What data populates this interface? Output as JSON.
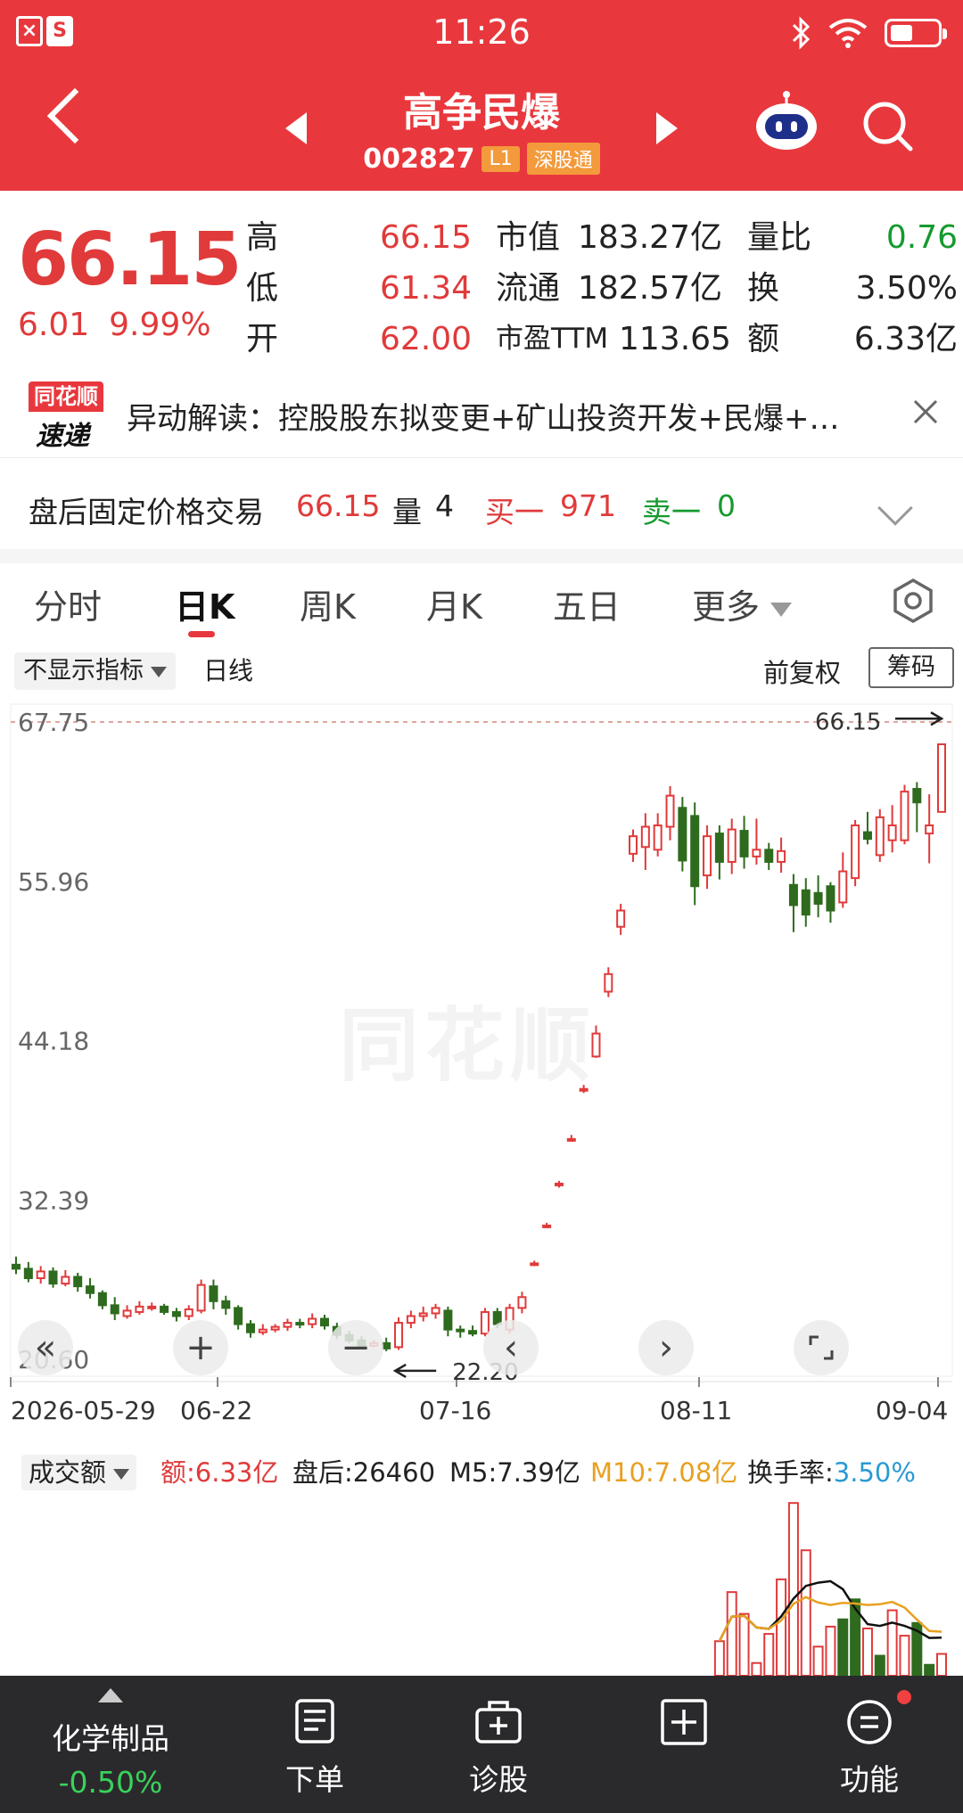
{
  "status": {
    "time": "11:26"
  },
  "header": {
    "stock_name": "高争民爆",
    "stock_code": "002827",
    "tags": [
      "L1",
      "深股通"
    ]
  },
  "quote": {
    "price": "66.15",
    "change": "6.01",
    "change_pct": "9.99%",
    "rows": [
      [
        {
          "label": "高",
          "value": "66.15"
        },
        {
          "label": "市值",
          "value": "183.27亿"
        },
        {
          "label": "量比",
          "value": "0.76"
        }
      ],
      [
        {
          "label": "低",
          "value": "61.34"
        },
        {
          "label": "流通",
          "value": "182.57亿"
        },
        {
          "label": "换",
          "value": "3.50%"
        }
      ],
      [
        {
          "label": "开",
          "value": "62.00"
        },
        {
          "label": "市盈TTM",
          "value": "113.65"
        },
        {
          "label": "额",
          "value": "6.33亿"
        }
      ]
    ]
  },
  "alert": {
    "logo_top": "同花顺",
    "logo_bottom": "速递",
    "text": "异动解读：控股股东拟变更+矿山投资开发+民爆+…"
  },
  "after_hours": {
    "label": "盘后固定价格交易",
    "price": "66.15",
    "vol_label": "量",
    "vol": "4",
    "buy_label": "买一",
    "buy": "971",
    "sell_label": "卖一",
    "sell": "0"
  },
  "tabs": [
    "分时",
    "日K",
    "周K",
    "月K",
    "五日",
    "更多"
  ],
  "active_tab": "日K",
  "chart_toolbar": {
    "indicator": "不显示指标",
    "line_type": "日线",
    "adjust": "前复权",
    "chips": "筹码"
  },
  "chart_data": {
    "type": "candlestick",
    "y_ticks": [
      "67.75",
      "55.96",
      "44.18",
      "32.39",
      "20.60"
    ],
    "ylim": [
      20.6,
      67.75
    ],
    "x_ticks": [
      "2026-05-29",
      "06-22",
      "07-16",
      "08-11",
      "09-04"
    ],
    "high_marker": "66.15",
    "low_marker": "22.20",
    "candles": [
      [
        27.6,
        27.3,
        28.2,
        26.9
      ],
      [
        27.3,
        26.6,
        27.8,
        26.3
      ],
      [
        26.6,
        27.1,
        27.5,
        26.2
      ],
      [
        27.1,
        26.2,
        27.4,
        25.9
      ],
      [
        26.2,
        26.7,
        27.2,
        26.0
      ],
      [
        26.7,
        26.0,
        27.0,
        25.6
      ],
      [
        26.0,
        25.5,
        26.6,
        25.1
      ],
      [
        25.5,
        24.6,
        25.7,
        24.3
      ],
      [
        24.6,
        24.0,
        25.2,
        23.5
      ],
      [
        23.8,
        24.2,
        24.6,
        23.6
      ],
      [
        24.1,
        24.5,
        24.9,
        23.9
      ],
      [
        24.5,
        24.5,
        24.8,
        24.2
      ],
      [
        24.5,
        24.1,
        24.7,
        23.9
      ],
      [
        24.1,
        23.8,
        24.4,
        23.4
      ],
      [
        23.8,
        24.3,
        24.6,
        23.5
      ],
      [
        24.2,
        26.1,
        26.5,
        24.0
      ],
      [
        26.0,
        24.9,
        26.5,
        24.3
      ],
      [
        24.9,
        24.4,
        25.3,
        23.9
      ],
      [
        24.4,
        23.2,
        24.6,
        22.8
      ],
      [
        23.2,
        22.6,
        23.5,
        22.2
      ],
      [
        22.6,
        22.8,
        23.2,
        22.4
      ],
      [
        22.8,
        23.0,
        23.2,
        22.6
      ],
      [
        23.0,
        23.3,
        23.6,
        22.7
      ],
      [
        23.3,
        23.2,
        23.6,
        22.9
      ],
      [
        23.2,
        23.6,
        24.0,
        22.9
      ],
      [
        23.6,
        23.1,
        23.9,
        22.8
      ],
      [
        23.0,
        22.4,
        23.3,
        22.1
      ],
      [
        22.4,
        22.0,
        22.7,
        21.8
      ],
      [
        22.0,
        21.6,
        22.3,
        21.4
      ],
      [
        21.6,
        21.8,
        22.0,
        21.5
      ],
      [
        21.8,
        21.4,
        22.2,
        21.2
      ],
      [
        21.5,
        23.3,
        23.7,
        21.3
      ],
      [
        23.3,
        23.8,
        24.2,
        22.9
      ],
      [
        23.8,
        24.0,
        24.5,
        23.4
      ],
      [
        24.0,
        24.4,
        24.7,
        23.6
      ],
      [
        24.2,
        22.8,
        24.5,
        22.3
      ],
      [
        22.8,
        22.7,
        23.1,
        22.2
      ],
      [
        22.7,
        22.5,
        23.1,
        22.3
      ],
      [
        22.5,
        24.1,
        24.4,
        22.3
      ],
      [
        24.1,
        23.2,
        24.4,
        22.9
      ],
      [
        22.8,
        24.4,
        24.7,
        22.5
      ],
      [
        24.4,
        25.2,
        25.6,
        24.0
      ],
      [
        27.7,
        27.7,
        27.9,
        27.5
      ],
      [
        30.5,
        30.5,
        30.7,
        30.3
      ],
      [
        33.5,
        33.6,
        33.8,
        33.3
      ],
      [
        36.9,
        36.9,
        37.2,
        36.7
      ],
      [
        40.6,
        40.6,
        40.9,
        40.3
      ],
      [
        43.0,
        44.7,
        45.3,
        42.9
      ],
      [
        47.8,
        49.1,
        49.6,
        47.4
      ],
      [
        52.6,
        53.8,
        54.3,
        52.0
      ],
      [
        58.0,
        59.3,
        59.8,
        57.4
      ],
      [
        58.5,
        60.0,
        61.0,
        56.8
      ],
      [
        58.3,
        60.1,
        61.0,
        57.8
      ],
      [
        60.0,
        62.3,
        63.0,
        59.0
      ],
      [
        61.4,
        57.5,
        62.2,
        56.7
      ],
      [
        60.8,
        55.6,
        61.8,
        54.2
      ],
      [
        56.4,
        59.3,
        60.1,
        55.4
      ],
      [
        59.5,
        57.4,
        60.1,
        56.1
      ],
      [
        57.4,
        59.8,
        60.6,
        56.5
      ],
      [
        59.7,
        57.8,
        60.8,
        56.9
      ],
      [
        57.8,
        58.3,
        60.6,
        57.2
      ],
      [
        58.3,
        57.4,
        58.8,
        56.8
      ],
      [
        57.4,
        58.2,
        59.2,
        56.6
      ],
      [
        55.7,
        54.2,
        56.5,
        52.2
      ],
      [
        55.3,
        53.5,
        56.2,
        52.6
      ],
      [
        55.1,
        54.3,
        56.4,
        53.3
      ],
      [
        55.6,
        53.8,
        55.9,
        52.9
      ],
      [
        54.4,
        56.7,
        58.1,
        54.0
      ],
      [
        56.2,
        60.1,
        60.5,
        55.6
      ],
      [
        59.6,
        59.1,
        61.1,
        58.7
      ],
      [
        57.9,
        60.7,
        61.3,
        57.4
      ],
      [
        59.0,
        60.1,
        61.6,
        58.1
      ],
      [
        59.0,
        62.6,
        63.1,
        58.7
      ],
      [
        62.8,
        61.8,
        63.3,
        59.6
      ],
      [
        59.5,
        60.1,
        62.4,
        57.3
      ],
      [
        61.1,
        66.1,
        66.1,
        61.1
      ]
    ]
  },
  "chart_controls": [
    "«",
    "+",
    "−",
    "‹",
    "›"
  ],
  "volume": {
    "selector": "成交额",
    "amount_label": "额:",
    "amount": "6.33亿",
    "after_label": "盘后:",
    "after": "26460",
    "m5_label": "M5:",
    "m5": "7.39亿",
    "m10_label": "M10:",
    "m10": "7.08亿",
    "turnover_label": "换手率:",
    "turnover": "3.50%",
    "bars": [
      0.19,
      0.46,
      0.34,
      0.07,
      0.23,
      0.53,
      0.95,
      0.69,
      0.16,
      0.27,
      0.31,
      0.42,
      0.26,
      0.11,
      0.36,
      0.22,
      0.29,
      0.06,
      0.12
    ],
    "bar_dirs": [
      "up",
      "up",
      "up",
      "up",
      "up",
      "up",
      "up",
      "up",
      "up",
      "up",
      "down",
      "down",
      "up",
      "down",
      "up",
      "up",
      "down",
      "down",
      "up"
    ]
  },
  "colors": {
    "up": "#e03a3a",
    "down": "#2e6b1e",
    "m5": "#111111",
    "m10": "#e8a020",
    "turnover": "#2a9ad2"
  },
  "bottom_bar": {
    "sector": "化学制品",
    "sector_pct": "-0.50%",
    "items": [
      "下单",
      "诊股",
      "",
      "功能"
    ]
  }
}
